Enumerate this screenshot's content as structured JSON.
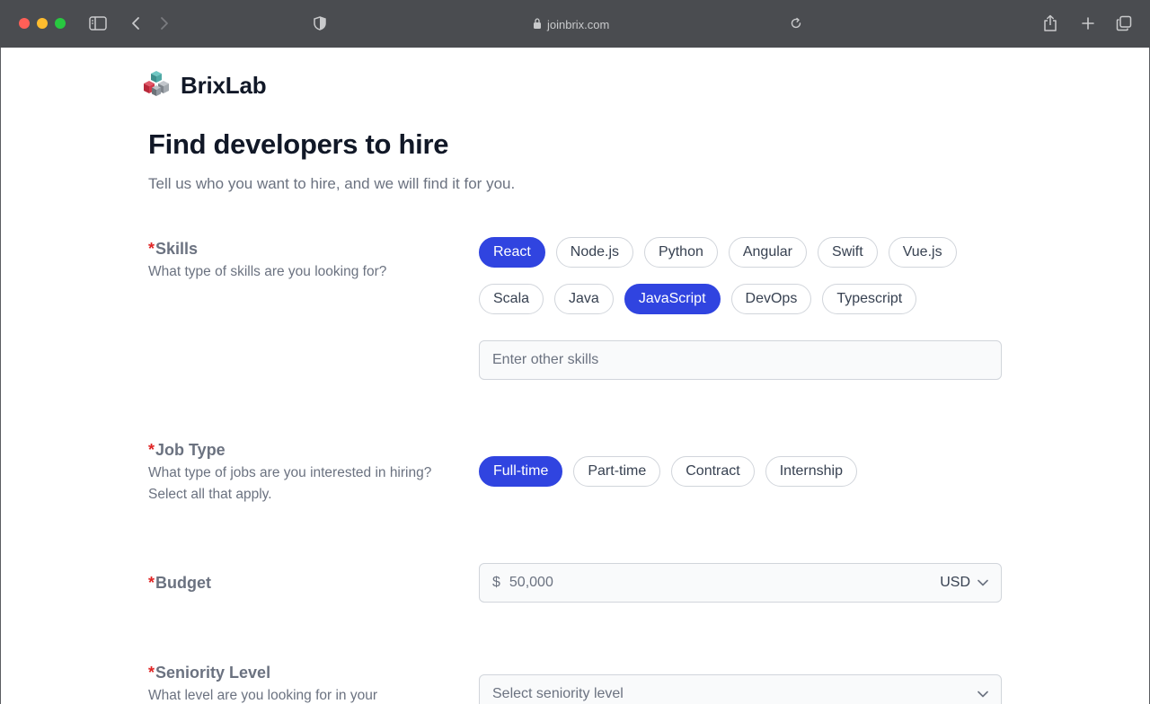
{
  "browser": {
    "url": "joinbrix.com"
  },
  "brand": {
    "name": "BrixLab",
    "logo_icon": "cubes-logo-icon"
  },
  "header": {
    "title": "Find developers to hire",
    "subtitle": "Tell us who you want to hire, and we will find it for you."
  },
  "skills": {
    "label": "Skills",
    "required_mark": "*",
    "help": "What type of skills are you looking for?",
    "options": [
      {
        "label": "React",
        "selected": true
      },
      {
        "label": "Node.js",
        "selected": false
      },
      {
        "label": "Python",
        "selected": false
      },
      {
        "label": "Angular",
        "selected": false
      },
      {
        "label": "Swift",
        "selected": false
      },
      {
        "label": "Vue.js",
        "selected": false
      },
      {
        "label": "Scala",
        "selected": false
      },
      {
        "label": "Java",
        "selected": false
      },
      {
        "label": "JavaScript",
        "selected": true
      },
      {
        "label": "DevOps",
        "selected": false
      },
      {
        "label": "Typescript",
        "selected": false
      }
    ],
    "other_placeholder": "Enter other skills"
  },
  "job_type": {
    "label": "Job Type",
    "required_mark": "*",
    "help": "What type of jobs are you interested in hiring? Select all that apply.",
    "options": [
      {
        "label": "Full-time",
        "selected": true
      },
      {
        "label": "Part-time",
        "selected": false
      },
      {
        "label": "Contract",
        "selected": false
      },
      {
        "label": "Internship",
        "selected": false
      }
    ]
  },
  "budget": {
    "label": "Budget",
    "required_mark": "*",
    "prefix": "$",
    "placeholder": "50,000",
    "currency": "USD"
  },
  "seniority": {
    "label": "Seniority Level",
    "required_mark": "*",
    "help": "What level are you looking for in your",
    "placeholder": "Select seniority level"
  },
  "colors": {
    "accent": "#3044e0",
    "required": "#e02424"
  }
}
